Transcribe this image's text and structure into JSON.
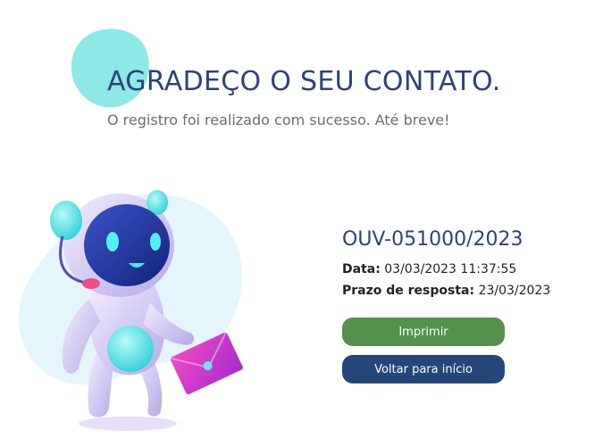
{
  "header": {
    "title": "AGRADEÇO O SEU CONTATO.",
    "subtitle": "O registro foi realizado com sucesso. Até breve!"
  },
  "record": {
    "protocol": "OUV-051000/2023",
    "date_label": "Data:",
    "date_value": "03/03/2023 11:37:55",
    "deadline_label": "Prazo de resposta:",
    "deadline_value": "23/03/2023"
  },
  "actions": {
    "print_label": "Imprimir",
    "home_label": "Voltar para início"
  },
  "colors": {
    "title": "#2a4478",
    "print_button": "#52914c",
    "home_button": "#254678",
    "accent_blob": "#8ee8e6"
  }
}
